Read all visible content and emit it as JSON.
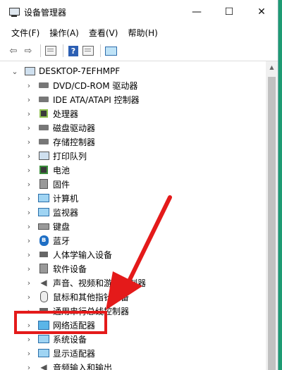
{
  "window": {
    "title": "设备管理器",
    "minimize": "—",
    "maximize": "☐",
    "close": "✕"
  },
  "menu": [
    "文件(F)",
    "操作(A)",
    "查看(V)",
    "帮助(H)"
  ],
  "toolbar": {
    "back": "⇦",
    "forward": "⇨",
    "help": "?"
  },
  "tree": {
    "root": "DESKTOP-7EFHMPF",
    "children": [
      {
        "label": "DVD/CD-ROM 驱动器",
        "icon": "disc-drive-icon"
      },
      {
        "label": "IDE ATA/ATAPI 控制器",
        "icon": "ide-controller-icon"
      },
      {
        "label": "处理器",
        "icon": "processor-icon"
      },
      {
        "label": "磁盘驱动器",
        "icon": "disk-drive-icon"
      },
      {
        "label": "存储控制器",
        "icon": "storage-controller-icon"
      },
      {
        "label": "打印队列",
        "icon": "printer-icon"
      },
      {
        "label": "电池",
        "icon": "battery-icon"
      },
      {
        "label": "固件",
        "icon": "firmware-icon"
      },
      {
        "label": "计算机",
        "icon": "computer-icon"
      },
      {
        "label": "监视器",
        "icon": "monitor-icon"
      },
      {
        "label": "键盘",
        "icon": "keyboard-icon"
      },
      {
        "label": "蓝牙",
        "icon": "bluetooth-icon"
      },
      {
        "label": "人体学输入设备",
        "icon": "hid-icon"
      },
      {
        "label": "软件设备",
        "icon": "software-device-icon"
      },
      {
        "label": "声音、视频和游戏控制器",
        "icon": "speaker-icon"
      },
      {
        "label": "鼠标和其他指针设备",
        "icon": "mouse-icon"
      },
      {
        "label": "通用串行总线控制器",
        "icon": "usb-icon"
      },
      {
        "label": "网络适配器",
        "icon": "network-adapter-icon"
      },
      {
        "label": "系统设备",
        "icon": "system-device-icon"
      },
      {
        "label": "显示适配器",
        "icon": "display-adapter-icon"
      },
      {
        "label": "音频输入和输出",
        "icon": "audio-io-icon"
      }
    ]
  },
  "colors": {
    "desktop": "#1e9b73",
    "annotation": "#e41a1a"
  }
}
